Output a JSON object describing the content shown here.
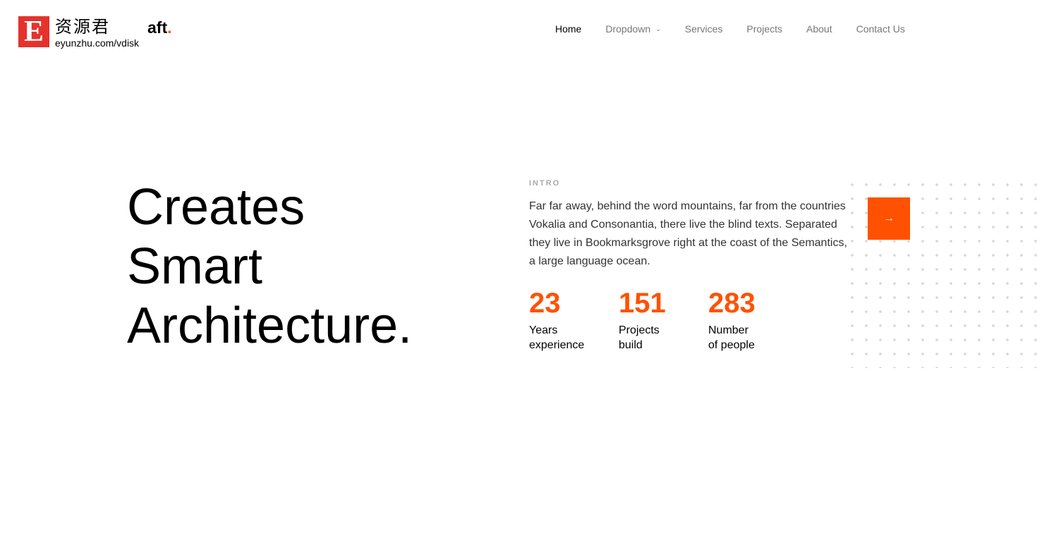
{
  "logo": {
    "letter": "E",
    "cn": "资源君",
    "url": "eyunzhu.com/vdisk"
  },
  "brand": {
    "text": "aft",
    "dot": "."
  },
  "nav": [
    {
      "label": "Home"
    },
    {
      "label": "Dropdown"
    },
    {
      "label": "Services"
    },
    {
      "label": "Projects"
    },
    {
      "label": "About"
    },
    {
      "label": "Contact Us"
    }
  ],
  "hero": {
    "line1": "Creates",
    "line2": "Smart",
    "line3": "Architecture."
  },
  "intro": {
    "label": "INTRO",
    "text": "Far far away, behind the word mountains, far from the countries Vokalia and Consonantia, there live the blind texts. Separated they live in Bookmarksgrove right at the coast of the Semantics, a large language ocean."
  },
  "stats": [
    {
      "value": "23",
      "l1": "Years",
      "l2": "experience"
    },
    {
      "value": "151",
      "l1": "Projects",
      "l2": "build"
    },
    {
      "value": "283",
      "l1": "Number",
      "l2": "of people"
    }
  ],
  "accent": "#ff5100",
  "arrow_icon": "→"
}
